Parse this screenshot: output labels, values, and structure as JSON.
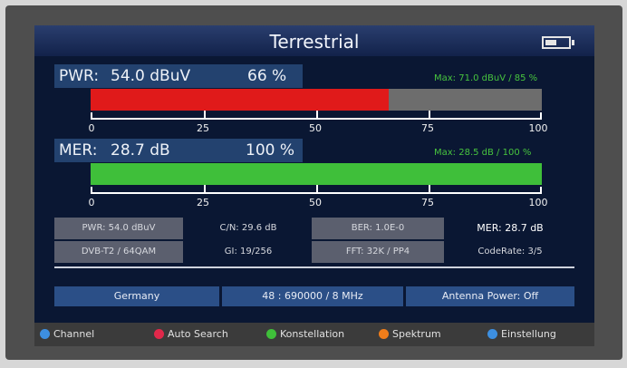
{
  "title": "Terrestrial",
  "pwr": {
    "label": "PWR:",
    "value": "54.0 dBuV",
    "percent_text": "66 %",
    "max": "Max: 71.0 dBuV / 85 %",
    "level": 0.66,
    "color": "#e01a1a"
  },
  "mer": {
    "label": "MER:",
    "value": "28.7 dB",
    "percent_text": "100 %",
    "max": "Max: 28.5 dB / 100 %",
    "level": 1.0,
    "color": "#3fbf3a"
  },
  "scale_labels": [
    "0",
    "25",
    "50",
    "75",
    "100"
  ],
  "params": {
    "pwr": "PWR: 54.0 dBuV",
    "cn": "C/N: 29.6 dB",
    "ber": "BER: 1.0E-0",
    "mer": "MER: 28.7 dB",
    "standard": "DVB-T2 / 64QAM",
    "gi": "GI: 19/256",
    "fft": "FFT: 32K / PP4",
    "coderate": "CodeRate: 3/5"
  },
  "info": {
    "country": "Germany",
    "channel": "48 : 690000 / 8 MHz",
    "antenna": "Antenna Power: Off"
  },
  "footer": [
    {
      "label": "Channel",
      "color": "#3d8fe0",
      "icon": "move-icon"
    },
    {
      "label": "Auto Search",
      "color": "#e0284a",
      "icon": "red-button-icon"
    },
    {
      "label": "Konstellation",
      "color": "#3fbf3a",
      "icon": "green-button-icon"
    },
    {
      "label": "Spektrum",
      "color": "#f07d1a",
      "icon": "orange-button-icon"
    },
    {
      "label": "Einstellung",
      "color": "#3d8fe0",
      "icon": "blue-button-icon"
    }
  ]
}
